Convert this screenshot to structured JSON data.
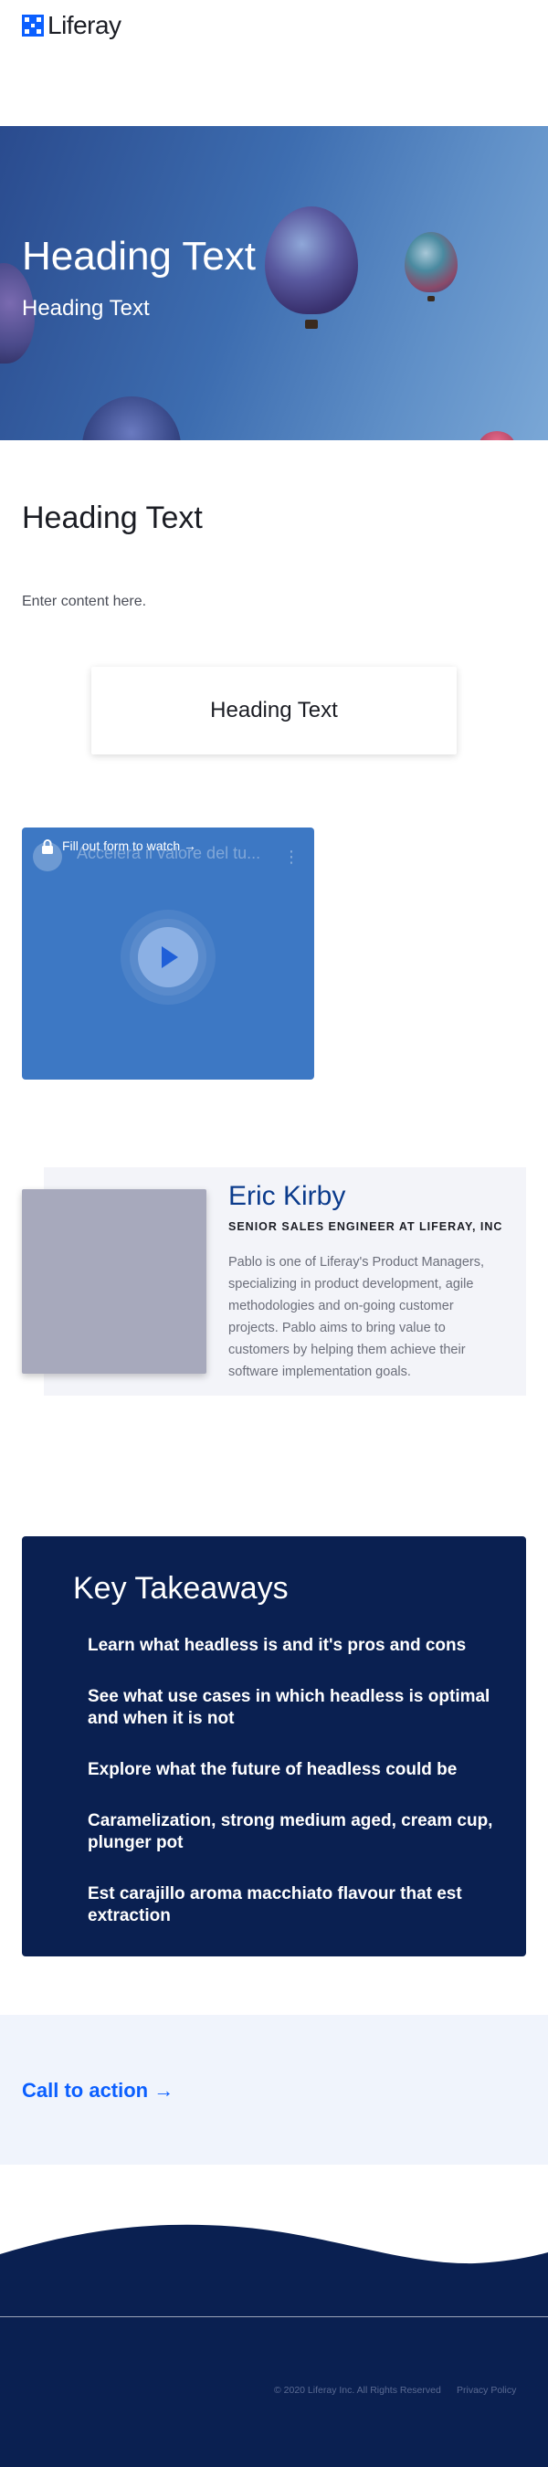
{
  "header": {
    "logo_text": "Liferay",
    "logo_icon": "liferay-logo-icon"
  },
  "hero": {
    "heading": "Heading Text",
    "subheading": "Heading Text"
  },
  "content": {
    "heading": "Heading Text",
    "body": "Enter content here."
  },
  "card": {
    "heading": "Heading Text"
  },
  "video": {
    "title": "Accelera il valore del tu...",
    "lock_label": "Fill out form to watch →",
    "menu_icon": "more-vertical-icon",
    "play_icon": "play-icon"
  },
  "profile": {
    "name": "Eric Kirby",
    "role": "SENIOR SALES ENGINEER AT LIFERAY, INC",
    "bio": "Pablo is one of Liferay's Product Managers, specializing in product development, agile methodologies and on-going customer projects. Pablo aims to bring value to customers by helping them achieve their software implementation goals."
  },
  "takeaways": {
    "title": "Key Takeaways",
    "items": [
      "Learn what headless is and it's pros and cons",
      "See what use cases in which headless is optimal and when it is not",
      "Explore what the future of headless could be",
      "Caramelization, strong medium aged, cream cup, plunger pot",
      "Est carajillo aroma macchiato flavour that est extraction"
    ]
  },
  "cta": {
    "label": "Call to action →"
  },
  "footer": {
    "copyright": "© 2020 Liferay Inc. All Rights Reserved",
    "privacy": "Privacy Policy"
  },
  "colors": {
    "brand": "#0b5fff",
    "navy": "#0a2051",
    "profile_name": "#0b3b8c",
    "cta_bg": "#f0f4fc"
  }
}
